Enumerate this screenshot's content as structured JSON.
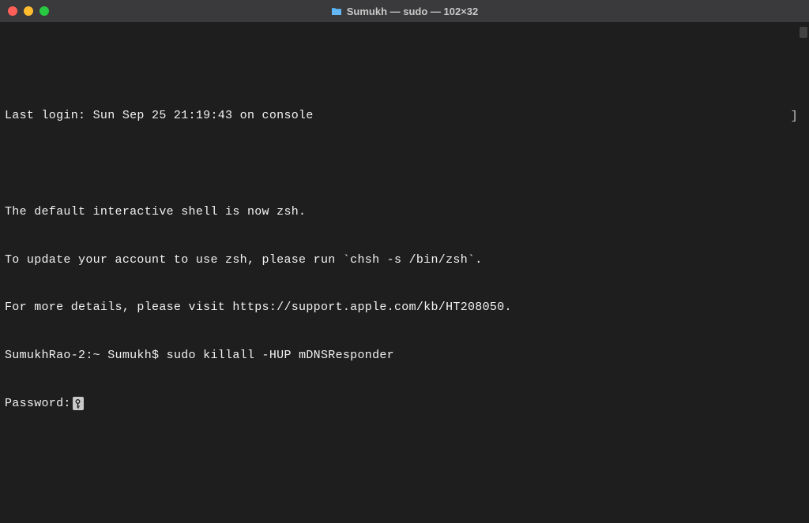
{
  "titlebar": {
    "title": "Sumukh — sudo — 102×32"
  },
  "terminal": {
    "lines": {
      "last_login": "Last login: Sun Sep 25 21:19:43 on console",
      "blank1": "",
      "zsh_notice1": "The default interactive shell is now zsh.",
      "zsh_notice2": "To update your account to use zsh, please run `chsh -s /bin/zsh`.",
      "zsh_notice3": "For more details, please visit https://support.apple.com/kb/HT208050.",
      "prompt": "SumukhRao-2:~ Sumukh$ ",
      "command": "sudo killall -HUP mDNSResponder",
      "password_label": "Password:"
    },
    "floating_char": "]"
  }
}
